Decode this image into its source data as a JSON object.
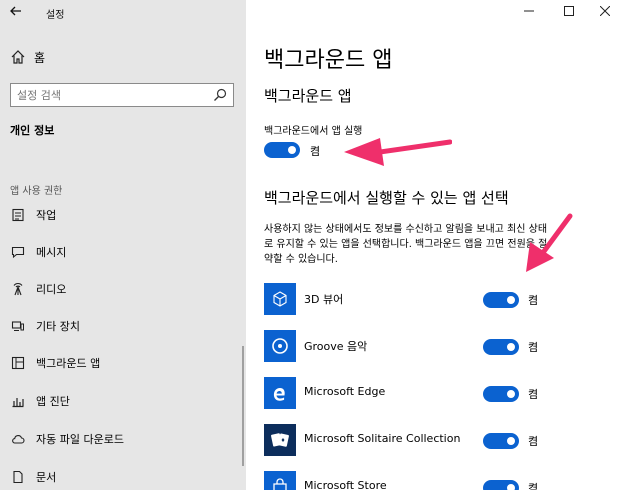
{
  "window": {
    "title": "설정"
  },
  "sidebar": {
    "home_label": "홈",
    "search_placeholder": "설정 검색",
    "section_title": "개인 정보",
    "perm_title": "앱 사용 권한",
    "items": [
      {
        "label": "작업",
        "icon": "task-icon"
      },
      {
        "label": "메시지",
        "icon": "message-icon"
      },
      {
        "label": "리디오",
        "icon": "radio-icon"
      },
      {
        "label": "기타 장치",
        "icon": "device-icon"
      },
      {
        "label": "백그라운드 앱",
        "icon": "background-app-icon"
      },
      {
        "label": "앱 진단",
        "icon": "diagnostics-icon"
      },
      {
        "label": "자동 파일 다운로드",
        "icon": "cloud-icon"
      },
      {
        "label": "문서",
        "icon": "document-icon"
      }
    ]
  },
  "main": {
    "page_title": "백그라운드 앱",
    "section1_title": "백그라운드 앱",
    "run_label": "백그라운드에서 앱 실행",
    "run_state": "켬",
    "section2_title": "백그라운드에서 실행할 수 있는 앱 선택",
    "description_lines": [
      "사용하지 않는 상태에서도 정보를 수신하고 알림을 보내고 최신 상태",
      "로 유지할 수 있는 앱을 선택합니다. 백그라운드 앱을 끄면 전원을 절",
      "약할 수 있습니다."
    ],
    "apps": [
      {
        "name": "3D 뷰어",
        "state": "켬",
        "icon": "cube-icon"
      },
      {
        "name": "Groove 음악",
        "state": "켬",
        "icon": "music-disc-icon"
      },
      {
        "name": "Microsoft Edge",
        "state": "켬",
        "icon": "edge-icon"
      },
      {
        "name": "Microsoft Solitaire Collection",
        "state": "켬",
        "icon": "cards-icon"
      },
      {
        "name": "Microsoft Store",
        "state": "켬",
        "icon": "store-bag-icon"
      }
    ]
  },
  "colors": {
    "accent": "#0b62d0",
    "sidebar_bg": "#e6e6e6",
    "annotation": "#ef2f6b"
  }
}
